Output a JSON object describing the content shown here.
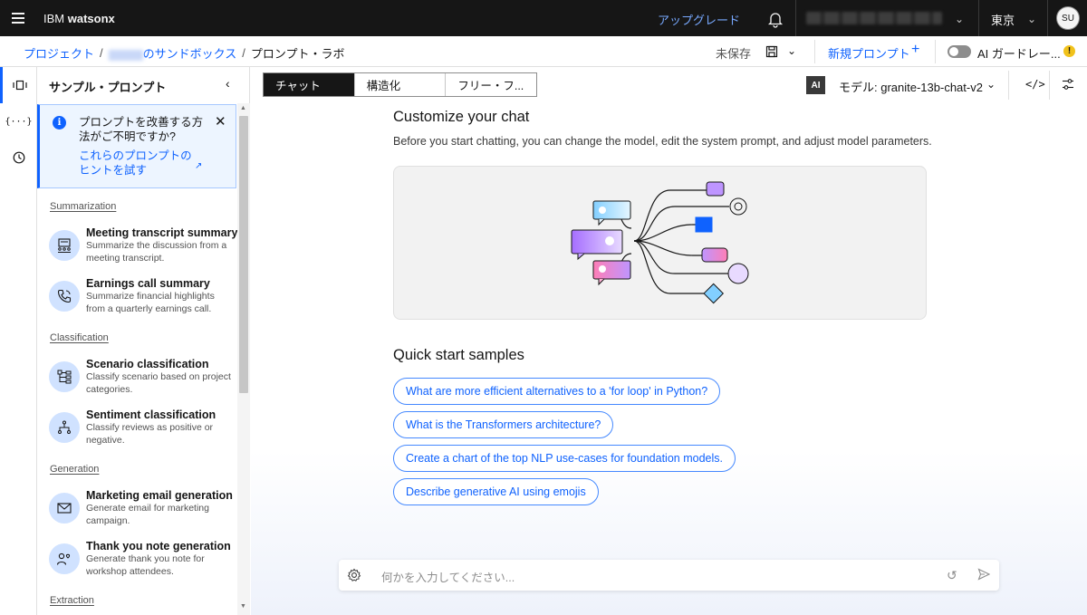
{
  "topbar": {
    "brand_light": "IBM ",
    "brand_bold": "watsonx",
    "upgrade": "アップグレード",
    "region": "東京",
    "avatar": "SU"
  },
  "breadcrumb": {
    "project": "プロジェクト",
    "sandbox_suffix": "のサンドボックス",
    "current": "プロンプト・ラボ"
  },
  "toolbar": {
    "unsaved": "未保存",
    "new_prompt": "新規プロンプト",
    "guardrails": "AI ガードレー...",
    "warning": "!"
  },
  "sidebar": {
    "title": "サンプル・プロンプト",
    "notice": {
      "text": "プロンプトを改善する方法がご不明ですか?",
      "link": "これらのプロンプトのヒントを試す"
    },
    "categories": [
      {
        "name": "Summarization",
        "items": [
          {
            "title": "Meeting transcript summary",
            "desc": "Summarize the discussion from a meeting transcript."
          },
          {
            "title": "Earnings call summary",
            "desc": "Summarize financial highlights from a quarterly earnings call."
          }
        ]
      },
      {
        "name": "Classification",
        "items": [
          {
            "title": "Scenario classification",
            "desc": "Classify scenario based on project categories."
          },
          {
            "title": "Sentiment classification",
            "desc": "Classify reviews as positive or negative."
          }
        ]
      },
      {
        "name": "Generation",
        "items": [
          {
            "title": "Marketing email generation",
            "desc": "Generate email for marketing campaign."
          },
          {
            "title": "Thank you note generation",
            "desc": "Generate thank you note for workshop attendees."
          }
        ]
      },
      {
        "name": "Extraction",
        "items": []
      }
    ]
  },
  "main": {
    "tabs": [
      "チャット",
      "構造化",
      "フリー・フ..."
    ],
    "ai_badge": "AI",
    "model": "モデル: granite-13b-chat-v2",
    "code_icon": "</>",
    "customize_title": "Customize your chat",
    "customize_desc": "Before you start chatting, you can change the model, edit the system prompt, and adjust model parameters.",
    "quick_title": "Quick start samples",
    "samples": [
      "What are more efficient alternatives to a 'for loop' in Python?",
      "What is the Transformers architecture?",
      "Create a chart of the top NLP use-cases for foundation models.",
      "Describe generative AI using emojis"
    ],
    "input_placeholder": "何かを入力してください..."
  },
  "colors": {
    "accent": "#0f62fe",
    "topbar_bg": "#161616",
    "chip_border": "#4589ff",
    "notice_bg": "#edf5ff",
    "icon_circle": "#d0e2ff"
  },
  "icons": {
    "hamburger": "menu-icon",
    "bell": "notification-icon",
    "save": "save-icon",
    "add": "add-icon",
    "info": "information-icon",
    "close": "close-icon",
    "launch": "launch-icon",
    "rail": [
      "prompt-lab-icon",
      "variables-icon",
      "history-icon"
    ]
  }
}
